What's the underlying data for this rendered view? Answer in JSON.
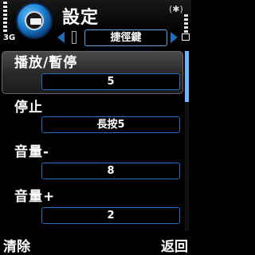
{
  "status": {
    "network": "3G",
    "bluetooth_icon": "(✱)"
  },
  "header": {
    "title": "設定",
    "tab_active": "捷徑鍵"
  },
  "items": [
    {
      "label": "播放/暫停",
      "value": "5"
    },
    {
      "label": "停止",
      "value": "長按5"
    },
    {
      "label": "音量-",
      "value": "8"
    },
    {
      "label": "音量+",
      "value": "2"
    }
  ],
  "softkeys": {
    "left": "清除",
    "right": "返回"
  },
  "colors": {
    "accent": "#1f6fc0",
    "highlight": "#3a3a3a"
  }
}
